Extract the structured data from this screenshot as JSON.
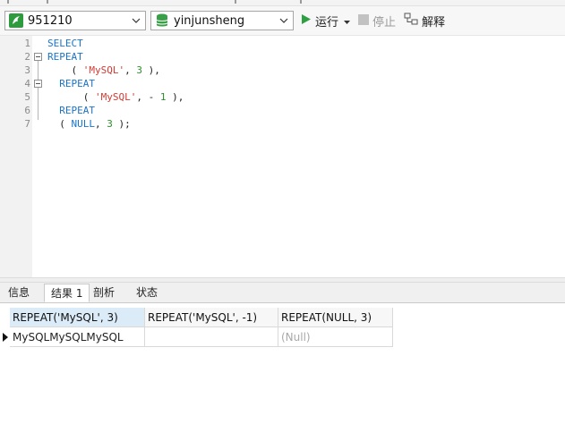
{
  "toolbar": {
    "connection": {
      "value": "951210",
      "icon": "dolphin-icon"
    },
    "database": {
      "value": "yinjunsheng",
      "icon": "database-icon"
    },
    "run_label": "运行",
    "stop_label": "停止",
    "explain_label": "解释"
  },
  "editor": {
    "line_numbers": [
      "1",
      "2",
      "3",
      "4",
      "5",
      "6",
      "7"
    ],
    "lines": [
      [
        {
          "t": "SELECT",
          "c": "kw"
        }
      ],
      [
        {
          "t": "REPEAT",
          "c": "kw"
        }
      ],
      [
        {
          "t": "    ( "
        },
        {
          "t": "'MySQL'",
          "c": "str"
        },
        {
          "t": ", "
        },
        {
          "t": "3",
          "c": "num"
        },
        {
          "t": " ),"
        }
      ],
      [
        {
          "t": "  "
        },
        {
          "t": "REPEAT",
          "c": "kw"
        }
      ],
      [
        {
          "t": "      ( "
        },
        {
          "t": "'MySQL'",
          "c": "str"
        },
        {
          "t": ", - "
        },
        {
          "t": "1",
          "c": "num"
        },
        {
          "t": " ),"
        }
      ],
      [
        {
          "t": "  "
        },
        {
          "t": "REPEAT",
          "c": "kw"
        }
      ],
      [
        {
          "t": "  ( "
        },
        {
          "t": "NULL",
          "c": "kw"
        },
        {
          "t": ", "
        },
        {
          "t": "3",
          "c": "num"
        },
        {
          "t": " );"
        }
      ]
    ]
  },
  "result_tabs": [
    "信息",
    "结果 1",
    "剖析",
    "状态"
  ],
  "result": {
    "columns": [
      "REPEAT('MySQL', 3)",
      "REPEAT('MySQL', -1)",
      "REPEAT(NULL, 3)"
    ],
    "rows": [
      [
        "MySQLMySQLMySQL",
        "",
        "(Null)"
      ]
    ]
  },
  "colors": {
    "keyword": "#1a74c6",
    "string": "#d23b34",
    "number": "#2f8f2f",
    "null_text": "#a8a8a8",
    "selected_header": "#dcebf8"
  }
}
